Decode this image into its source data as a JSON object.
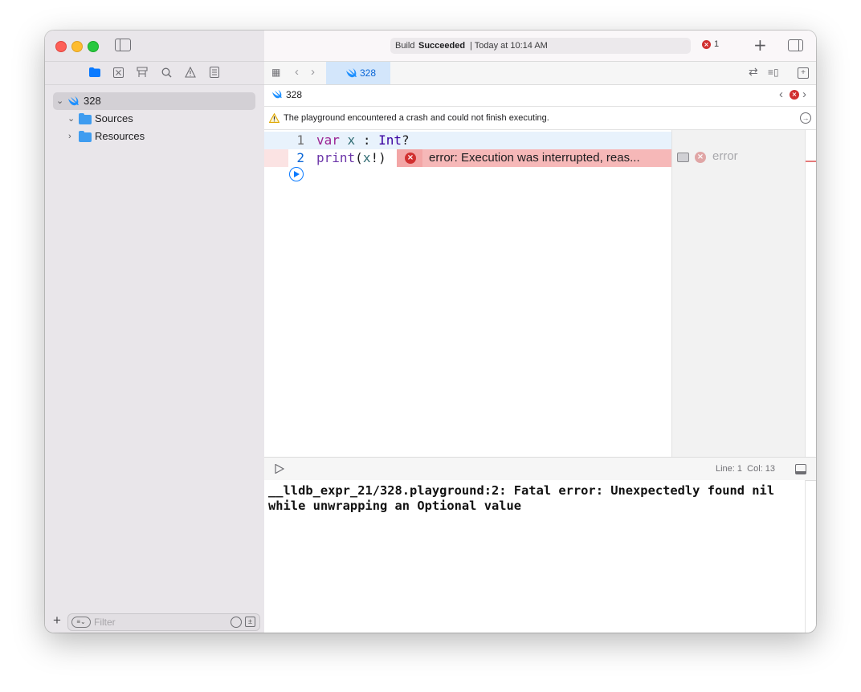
{
  "toolbar": {
    "status_prefix": "Build",
    "status_bold": "Succeeded",
    "status_suffix": "| Today at 10:14 AM",
    "error_count": "1",
    "add_symbol": "+"
  },
  "sidebar": {
    "project_name": "328",
    "items": [
      {
        "label": "Sources"
      },
      {
        "label": "Resources"
      }
    ],
    "filter_placeholder": "Filter",
    "add_symbol": "+"
  },
  "editor": {
    "tab_label": "328",
    "jump_label": "328",
    "warning_message": "The playground encountered a crash and could not finish executing.",
    "lines": [
      {
        "number": "1"
      },
      {
        "number": "2"
      }
    ],
    "inline_error": "error: Execution was interrupted, reas...",
    "result_label": "error"
  },
  "status": {
    "line_col": "Line: 1  Col: 13"
  },
  "console": {
    "output": "__lldb_expr_21/328.playground:2: Fatal error: Unexpectedly found nil while unwrapping an Optional value"
  },
  "colors": {
    "accent": "#0a66d6",
    "error": "#d12f2f",
    "error_bg": "#f6b8b8",
    "warning": "#f2b600"
  }
}
